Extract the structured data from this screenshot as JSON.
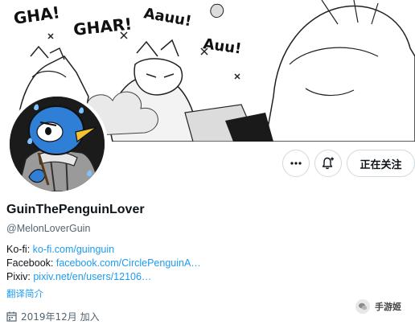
{
  "banner": {
    "sfx": [
      "GHA!",
      "GHAR!",
      "Aauu!",
      "Auu!"
    ]
  },
  "profile": {
    "display_name": "GuinThePenguinLover",
    "handle": "@MelonLoverGuin",
    "follow_label": "正在关注",
    "bio": {
      "kofi_label": "Ko-fi: ",
      "kofi_link": "ko-fi.com/guinguin",
      "facebook_label": "Facebook: ",
      "facebook_link": "facebook.com/CirclePenguinA…",
      "pixiv_label": "Pixiv: ",
      "pixiv_link": "pixiv.net/en/users/12106…"
    },
    "translate_label": "翻译简介",
    "joined_text": "2019年12月 加入"
  },
  "watermark": {
    "text": "手游姬"
  },
  "icons": {
    "more": "more-horizontal-icon",
    "bell": "notification-bell-icon",
    "calendar": "calendar-icon"
  }
}
